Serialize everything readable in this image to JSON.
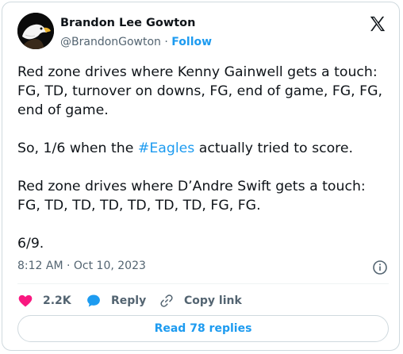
{
  "author": {
    "name": "Brandon Lee Gowton",
    "handle": "@BrandonGowton",
    "separator": "·",
    "follow_label": "Follow"
  },
  "tweet": {
    "line1": "Red zone drives where Kenny Gainwell gets a touch: FG, TD, turnover on downs, FG, end of game, FG, FG, end of game.",
    "line2_before": "So, 1/6 when the ",
    "line2_hashtag": "#Eagles",
    "line2_after": " actually tried to score.",
    "line3": "Red zone drives where D’Andre Swift gets a touch: FG, TD, TD, TD, TD, TD, TD, FG, FG.",
    "line4": "6/9."
  },
  "meta": {
    "timestamp": "8:12 AM · Oct 10, 2023"
  },
  "actions": {
    "like_count": "2.2K",
    "reply_label": "Reply",
    "copy_link_label": "Copy link"
  },
  "replies_button": {
    "label": "Read 78 replies"
  },
  "colors": {
    "accent": "#1d9bf0",
    "like": "#f91880",
    "muted": "#536471",
    "text": "#0f1419"
  },
  "icons": {
    "logo": "x-logo-icon",
    "info": "info-icon",
    "like": "heart-icon",
    "reply": "speech-bubble-icon",
    "copy": "link-icon"
  }
}
